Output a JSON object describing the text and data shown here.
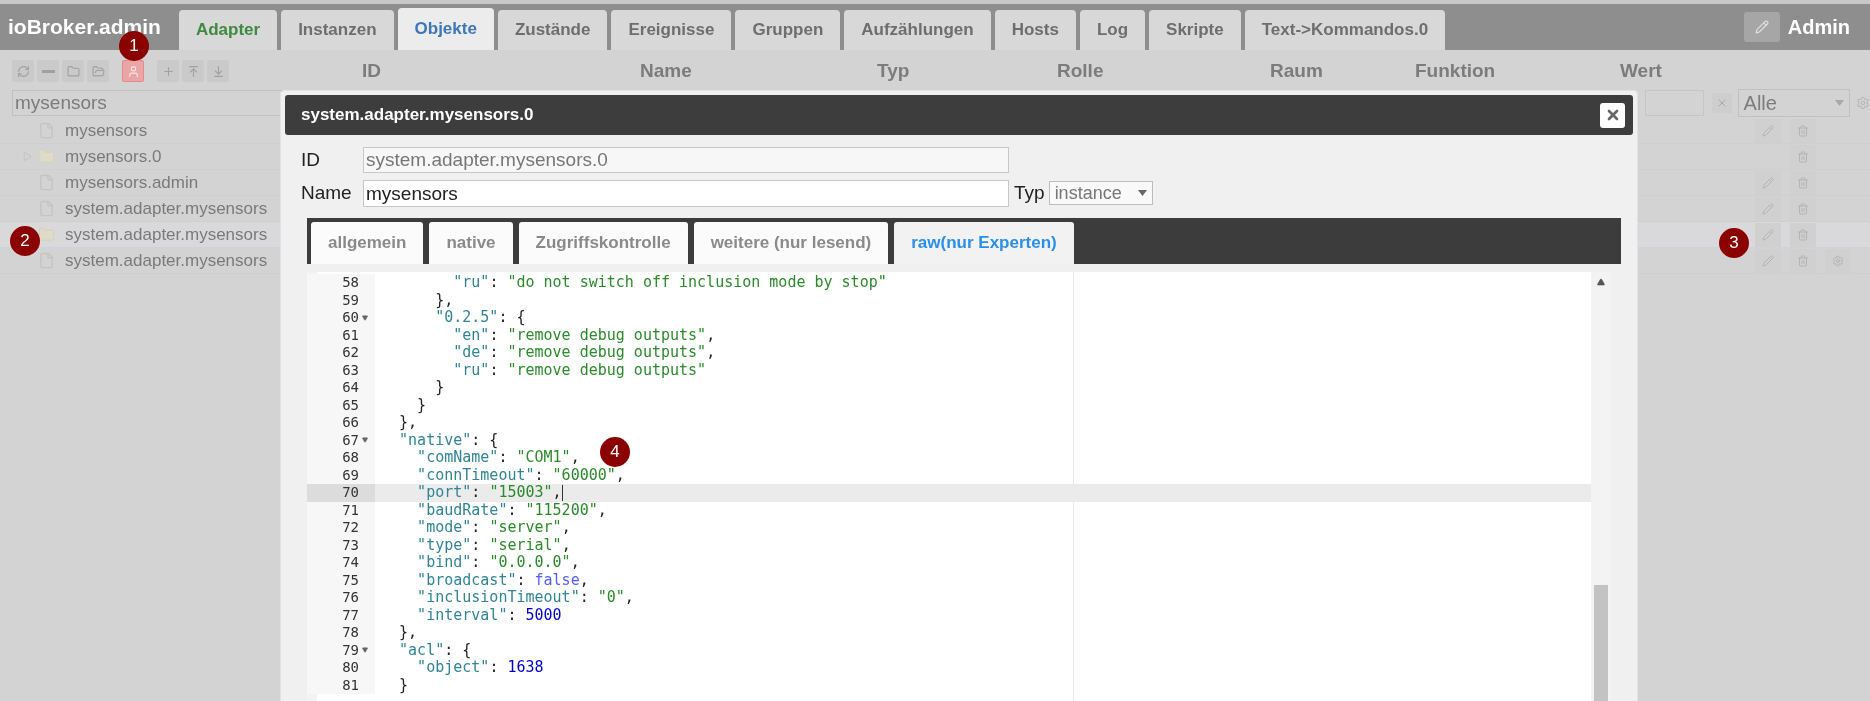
{
  "app": {
    "brand": "ioBroker.admin",
    "user": "Admin",
    "tabs": [
      {
        "label": "Adapter",
        "selected": false,
        "updates": true
      },
      {
        "label": "Instanzen",
        "selected": false,
        "updates": false
      },
      {
        "label": "Objekte",
        "selected": true,
        "updates": false
      },
      {
        "label": "Zustände",
        "selected": false,
        "updates": false
      },
      {
        "label": "Ereignisse",
        "selected": false,
        "updates": false
      },
      {
        "label": "Gruppen",
        "selected": false,
        "updates": false
      },
      {
        "label": "Aufzählungen",
        "selected": false,
        "updates": false
      },
      {
        "label": "Hosts",
        "selected": false,
        "updates": false
      },
      {
        "label": "Log",
        "selected": false,
        "updates": false
      },
      {
        "label": "Skripte",
        "selected": false,
        "updates": false
      },
      {
        "label": "Text->Kommandos.0",
        "selected": false,
        "updates": false
      }
    ]
  },
  "toolbar": [
    {
      "kind": "refresh",
      "selected": false
    },
    {
      "kind": "collapse",
      "selected": false
    },
    {
      "kind": "folder",
      "selected": false
    },
    {
      "kind": "folder-open",
      "selected": false
    },
    {
      "kind": "user",
      "selected": true
    },
    {
      "kind": "add",
      "selected": false
    },
    {
      "kind": "upload",
      "selected": false
    },
    {
      "kind": "download",
      "selected": false
    }
  ],
  "columns": [
    "ID",
    "Name",
    "Typ",
    "Rolle",
    "Raum",
    "Funktion",
    "Wert"
  ],
  "filter": {
    "value": "mysensors",
    "type_filter": "Alle"
  },
  "tree": [
    {
      "label": "mysensors",
      "kind": "file",
      "expandable": false,
      "selected": false,
      "edit": true,
      "settings": false
    },
    {
      "label": "mysensors.0",
      "kind": "folder",
      "expandable": true,
      "selected": false,
      "edit": false,
      "settings": false
    },
    {
      "label": "mysensors.admin",
      "kind": "file",
      "expandable": false,
      "selected": false,
      "edit": true,
      "settings": false
    },
    {
      "label": "system.adapter.mysensors",
      "kind": "file",
      "expandable": false,
      "selected": false,
      "edit": true,
      "settings": false
    },
    {
      "label": "system.adapter.mysensors",
      "kind": "folder",
      "expandable": false,
      "selected": true,
      "edit": true,
      "settings": false
    },
    {
      "label": "system.adapter.mysensors",
      "kind": "file",
      "expandable": false,
      "selected": false,
      "edit": true,
      "settings": true
    }
  ],
  "dialog": {
    "title": "system.adapter.mysensors.0",
    "id_label": "ID",
    "id_value": "system.adapter.mysensors.0",
    "name_label": "Name",
    "name_value": "mysensors",
    "type_label": "Typ",
    "type_value": "instance",
    "tabs": [
      {
        "label": "allgemein",
        "selected": false
      },
      {
        "label": "native",
        "selected": false
      },
      {
        "label": "Zugriffskontrolle",
        "selected": false
      },
      {
        "label": "weitere (nur lesend)",
        "selected": false
      },
      {
        "label": "raw(nur Experten)",
        "selected": true
      }
    ],
    "code": [
      {
        "n": "58",
        "fold": false,
        "active": false,
        "tokens": [
          {
            "kind": "key",
            "text": "        \"ru\""
          },
          {
            "kind": "punct",
            "text": ": "
          },
          {
            "kind": "string",
            "text": "\"do not switch off inclusion mode by stop\""
          }
        ]
      },
      {
        "n": "59",
        "fold": false,
        "active": false,
        "tokens": [
          {
            "kind": "punct",
            "text": "      },"
          }
        ]
      },
      {
        "n": "60",
        "fold": true,
        "active": false,
        "tokens": [
          {
            "kind": "key",
            "text": "      \"0.2.5\""
          },
          {
            "kind": "punct",
            "text": ": {"
          }
        ]
      },
      {
        "n": "61",
        "fold": false,
        "active": false,
        "tokens": [
          {
            "kind": "key",
            "text": "        \"en\""
          },
          {
            "kind": "punct",
            "text": ": "
          },
          {
            "kind": "string",
            "text": "\"remove debug outputs\""
          },
          {
            "kind": "punct",
            "text": ","
          }
        ]
      },
      {
        "n": "62",
        "fold": false,
        "active": false,
        "tokens": [
          {
            "kind": "key",
            "text": "        \"de\""
          },
          {
            "kind": "punct",
            "text": ": "
          },
          {
            "kind": "string",
            "text": "\"remove debug outputs\""
          },
          {
            "kind": "punct",
            "text": ","
          }
        ]
      },
      {
        "n": "63",
        "fold": false,
        "active": false,
        "tokens": [
          {
            "kind": "key",
            "text": "        \"ru\""
          },
          {
            "kind": "punct",
            "text": ": "
          },
          {
            "kind": "string",
            "text": "\"remove debug outputs\""
          }
        ]
      },
      {
        "n": "64",
        "fold": false,
        "active": false,
        "tokens": [
          {
            "kind": "punct",
            "text": "      }"
          }
        ]
      },
      {
        "n": "65",
        "fold": false,
        "active": false,
        "tokens": [
          {
            "kind": "punct",
            "text": "    }"
          }
        ]
      },
      {
        "n": "66",
        "fold": false,
        "active": false,
        "tokens": [
          {
            "kind": "punct",
            "text": "  },"
          }
        ]
      },
      {
        "n": "67",
        "fold": true,
        "active": false,
        "tokens": [
          {
            "kind": "key",
            "text": "  \"native\""
          },
          {
            "kind": "punct",
            "text": ": {"
          }
        ]
      },
      {
        "n": "68",
        "fold": false,
        "active": false,
        "tokens": [
          {
            "kind": "key",
            "text": "    \"comName\""
          },
          {
            "kind": "punct",
            "text": ": "
          },
          {
            "kind": "string",
            "text": "\"COM1\""
          },
          {
            "kind": "punct",
            "text": ","
          }
        ]
      },
      {
        "n": "69",
        "fold": false,
        "active": false,
        "tokens": [
          {
            "kind": "key",
            "text": "    \"connTimeout\""
          },
          {
            "kind": "punct",
            "text": ": "
          },
          {
            "kind": "string",
            "text": "\"60000\""
          },
          {
            "kind": "punct",
            "text": ","
          }
        ]
      },
      {
        "n": "70",
        "fold": false,
        "active": true,
        "tokens": [
          {
            "kind": "key",
            "text": "    \"port\""
          },
          {
            "kind": "punct",
            "text": ": "
          },
          {
            "kind": "string",
            "text": "\"15003\""
          },
          {
            "kind": "punct",
            "text": ","
          }
        ]
      },
      {
        "n": "71",
        "fold": false,
        "active": false,
        "tokens": [
          {
            "kind": "key",
            "text": "    \"baudRate\""
          },
          {
            "kind": "punct",
            "text": ": "
          },
          {
            "kind": "string",
            "text": "\"115200\""
          },
          {
            "kind": "punct",
            "text": ","
          }
        ]
      },
      {
        "n": "72",
        "fold": false,
        "active": false,
        "tokens": [
          {
            "kind": "key",
            "text": "    \"mode\""
          },
          {
            "kind": "punct",
            "text": ": "
          },
          {
            "kind": "string",
            "text": "\"server\""
          },
          {
            "kind": "punct",
            "text": ","
          }
        ]
      },
      {
        "n": "73",
        "fold": false,
        "active": false,
        "tokens": [
          {
            "kind": "key",
            "text": "    \"type\""
          },
          {
            "kind": "punct",
            "text": ": "
          },
          {
            "kind": "string",
            "text": "\"serial\""
          },
          {
            "kind": "punct",
            "text": ","
          }
        ]
      },
      {
        "n": "74",
        "fold": false,
        "active": false,
        "tokens": [
          {
            "kind": "key",
            "text": "    \"bind\""
          },
          {
            "kind": "punct",
            "text": ": "
          },
          {
            "kind": "string",
            "text": "\"0.0.0.0\""
          },
          {
            "kind": "punct",
            "text": ","
          }
        ]
      },
      {
        "n": "75",
        "fold": false,
        "active": false,
        "tokens": [
          {
            "kind": "key",
            "text": "    \"broadcast\""
          },
          {
            "kind": "punct",
            "text": ": "
          },
          {
            "kind": "bool",
            "text": "false"
          },
          {
            "kind": "punct",
            "text": ","
          }
        ]
      },
      {
        "n": "76",
        "fold": false,
        "active": false,
        "tokens": [
          {
            "kind": "key",
            "text": "    \"inclusionTimeout\""
          },
          {
            "kind": "punct",
            "text": ": "
          },
          {
            "kind": "string",
            "text": "\"0\""
          },
          {
            "kind": "punct",
            "text": ","
          }
        ]
      },
      {
        "n": "77",
        "fold": false,
        "active": false,
        "tokens": [
          {
            "kind": "key",
            "text": "    \"interval\""
          },
          {
            "kind": "punct",
            "text": ": "
          },
          {
            "kind": "number",
            "text": "5000"
          }
        ]
      },
      {
        "n": "78",
        "fold": false,
        "active": false,
        "tokens": [
          {
            "kind": "punct",
            "text": "  },"
          }
        ]
      },
      {
        "n": "79",
        "fold": true,
        "active": false,
        "tokens": [
          {
            "kind": "key",
            "text": "  \"acl\""
          },
          {
            "kind": "punct",
            "text": ": {"
          }
        ]
      },
      {
        "n": "80",
        "fold": false,
        "active": false,
        "tokens": [
          {
            "kind": "key",
            "text": "    \"object\""
          },
          {
            "kind": "punct",
            "text": ": "
          },
          {
            "kind": "number",
            "text": "1638"
          }
        ]
      },
      {
        "n": "81",
        "fold": false,
        "active": false,
        "tokens": [
          {
            "kind": "punct",
            "text": "  }"
          }
        ]
      }
    ]
  },
  "markers": [
    "1",
    "2",
    "3",
    "4"
  ]
}
